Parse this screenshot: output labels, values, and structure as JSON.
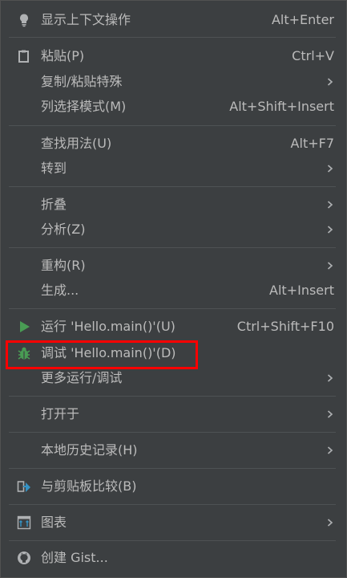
{
  "colors": {
    "background": "#3C3F41",
    "text": "#BBBBBB",
    "separator": "#4E5254",
    "run_icon": "#499C54",
    "debug_icon": "#499C54",
    "highlight_box": "#FF0000"
  },
  "menu": {
    "items": [
      {
        "label": "显示上下文操作",
        "shortcut": "Alt+Enter",
        "icon": "lightbulb-icon"
      },
      {
        "label": "粘贴(P)",
        "shortcut": "Ctrl+V",
        "icon": "clipboard-icon"
      },
      {
        "label": "复制/粘贴特殊",
        "submenu": true
      },
      {
        "label": "列选择模式(M)",
        "shortcut": "Alt+Shift+Insert"
      },
      {
        "label": "查找用法(U)",
        "shortcut": "Alt+F7"
      },
      {
        "label": "转到",
        "submenu": true
      },
      {
        "label": "折叠",
        "submenu": true
      },
      {
        "label": "分析(Z)",
        "submenu": true
      },
      {
        "label": "重构(R)",
        "submenu": true
      },
      {
        "label": "生成...",
        "shortcut": "Alt+Insert"
      },
      {
        "label": "运行 'Hello.main()'(U)",
        "shortcut": "Ctrl+Shift+F10",
        "icon": "run-icon"
      },
      {
        "label": "调试 'Hello.main()'(D)",
        "icon": "debug-bug-icon",
        "highlighted": true
      },
      {
        "label": "更多运行/调试",
        "submenu": true
      },
      {
        "label": "打开于",
        "submenu": true
      },
      {
        "label": "本地历史记录(H)",
        "submenu": true
      },
      {
        "label": "与剪贴板比较(B)",
        "icon": "compare-clipboard-icon"
      },
      {
        "label": "图表",
        "submenu": true,
        "icon": "diagram-icon"
      },
      {
        "label": "创建 Gist...",
        "icon": "github-icon"
      }
    ]
  }
}
